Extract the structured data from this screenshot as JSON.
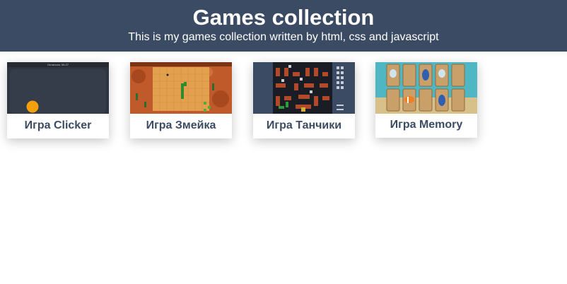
{
  "header": {
    "title": "Games collection",
    "subtitle": "This is my games collection written by html, css and javascript"
  },
  "games": [
    {
      "label": "Игра Clicker",
      "thumb_icon": "clicker-game-icon",
      "thumb_text": "Осталось: 06.27"
    },
    {
      "label": "Игра Змейка",
      "thumb_icon": "snake-game-icon"
    },
    {
      "label": "Игра Танчики",
      "thumb_icon": "tanks-game-icon"
    },
    {
      "label": "Игра Memory",
      "thumb_icon": "memory-game-icon"
    }
  ],
  "colors": {
    "header_bg": "#3c4b64",
    "header_text": "#ffffff",
    "card_label": "#3c4b64",
    "page_bg": "#ffffff"
  }
}
